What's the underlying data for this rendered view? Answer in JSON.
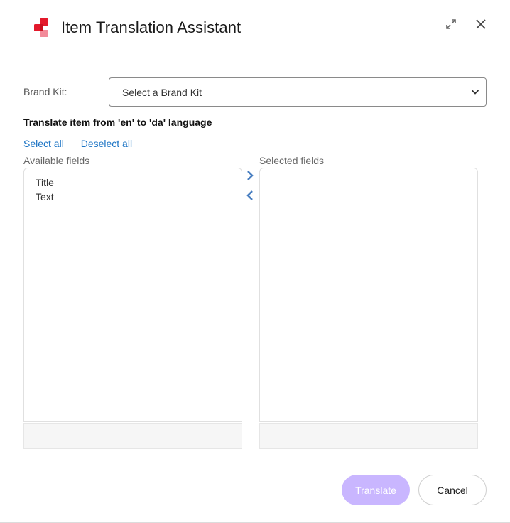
{
  "dialog": {
    "title": "Item Translation Assistant",
    "icons": {
      "logo": "app-logo-icon",
      "expand": "expand-icon",
      "close": "close-icon"
    }
  },
  "brand_kit": {
    "label": "Brand Kit:",
    "selected": "Select a Brand Kit"
  },
  "translate_heading": "Translate item from 'en' to 'da' language",
  "links": {
    "select_all": "Select all",
    "deselect_all": "Deselect all"
  },
  "available": {
    "label": "Available fields",
    "items": [
      "Title",
      "Text"
    ]
  },
  "selected": {
    "label": "Selected fields",
    "items": []
  },
  "buttons": {
    "translate": "Translate",
    "cancel": "Cancel"
  },
  "colors": {
    "accent": "#1a73c4",
    "translate_disabled": "#c9b6ff",
    "logo_red": "#e3192b",
    "logo_pink": "#f28b9a"
  }
}
